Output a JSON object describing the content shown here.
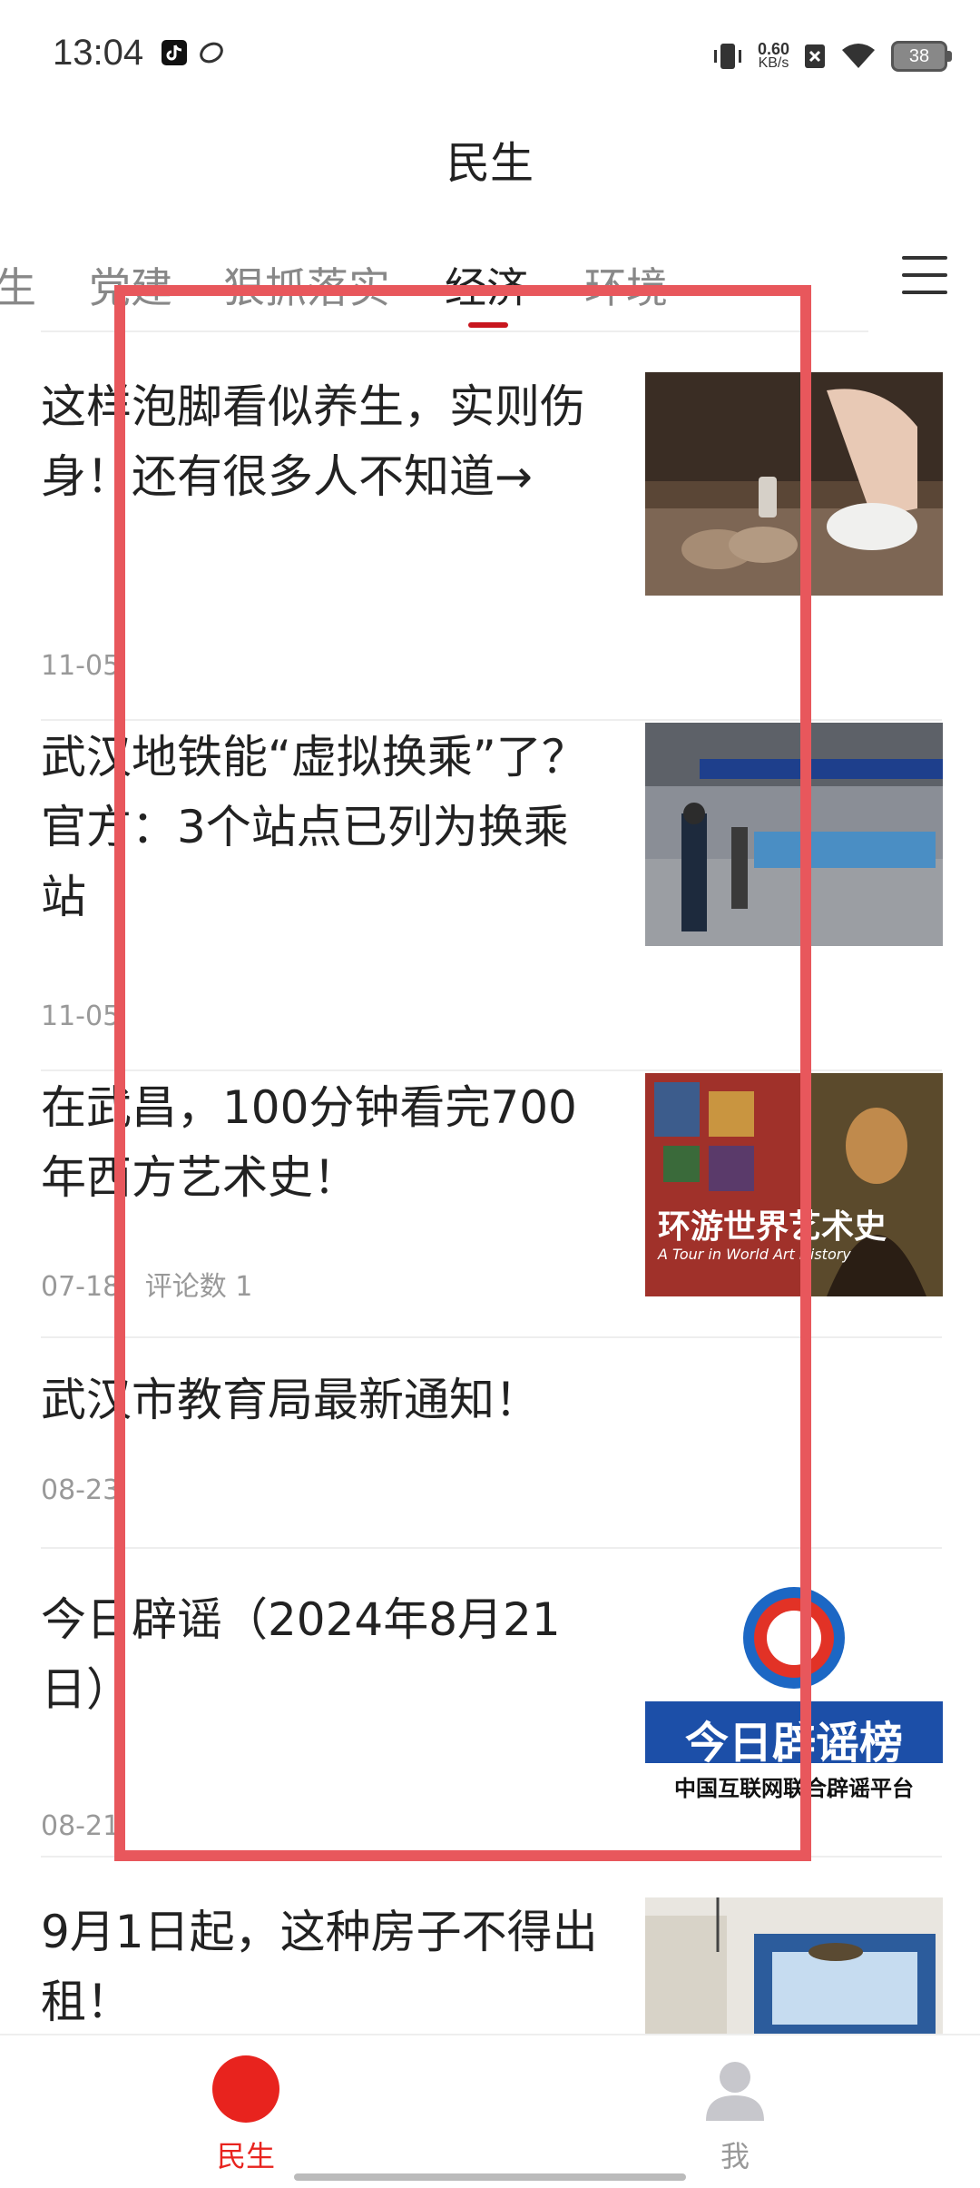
{
  "status": {
    "time": "13:04",
    "net_speed_value": "0.60",
    "net_speed_unit": "KB/s",
    "battery": "38"
  },
  "page_title": "民生",
  "tabs": [
    "生",
    "党建",
    "狠抓落实",
    "经济",
    "环境"
  ],
  "active_tab": "经济",
  "articles": [
    {
      "title": "这样泡脚看似养生，实则伤身！还有很多人不知道→",
      "date": "11-05",
      "comments": "",
      "image": "foot-bath-photo"
    },
    {
      "title": "武汉地铁能“虚拟换乘”了？官方：3个站点已列为换乘站",
      "date": "11-05",
      "comments": "",
      "image": "metro-station-photo"
    },
    {
      "title": "在武昌，100分钟看完700年西方艺术史！",
      "date": "07-18",
      "comments": "评论数 1",
      "image": "art-exhibition-poster",
      "image_text": "环游世界艺术史",
      "image_subtext": "A Tour in World Art History"
    },
    {
      "title": "武汉市教育局最新通知！",
      "date": "08-23",
      "comments": "",
      "image": ""
    },
    {
      "title": "今日辟谣（2024年8月21日）",
      "date": "08-21",
      "comments": "",
      "image": "rumor-list-logo",
      "image_text": "今日辟谣榜",
      "image_subtext": "中国互联网联合辟谣平台"
    },
    {
      "title": "9月1日起，这种房子不得出租！",
      "date": "",
      "comments": "",
      "image": "room-interior-photo"
    }
  ],
  "bottom_nav": [
    {
      "label": "民生",
      "icon": "home-icon",
      "active": true
    },
    {
      "label": "我",
      "icon": "user-icon",
      "active": false
    }
  ],
  "colors": {
    "accent": "#c8161e",
    "nav_active": "#e8231e",
    "overlay": "#e8575c"
  }
}
